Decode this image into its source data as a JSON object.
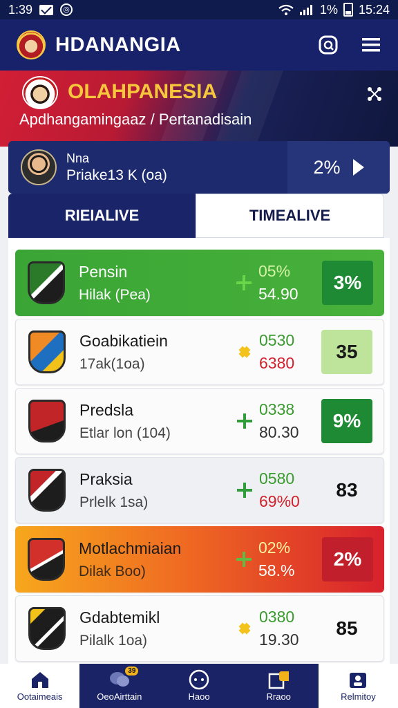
{
  "status_bar": {
    "time": "1:39",
    "battery": "1%",
    "clock": "15:24"
  },
  "app": {
    "title": "HDANANGIA"
  },
  "hero": {
    "brand": "OLAHPANESIA",
    "subtitle": "Apdhangamingaaz / Pertanadisain"
  },
  "profile": {
    "name": "Nna",
    "meta": "Priake13 K (oa)",
    "percent": "2%"
  },
  "tabs": [
    {
      "label": "RIEIALIVE",
      "active": false
    },
    {
      "label": "TIMEALIVE",
      "active": true
    }
  ],
  "rows": [
    {
      "team": "Pensin",
      "detail": "Hilak (Pea)",
      "top": "05%",
      "bottom": "54.90",
      "score": "3%",
      "score_style": "dark",
      "style": "green",
      "trend": "plus",
      "trend_color": "#69d64a",
      "bottom_red": false
    },
    {
      "team": "Goabikatiein",
      "detail": "17ak(1oa)",
      "top": "0530",
      "bottom": "6380",
      "score": "35",
      "score_style": "light",
      "style": "plain",
      "trend": "star",
      "trend_color": "#f3c21b",
      "bottom_red": true
    },
    {
      "team": "Predsla",
      "detail": "Etlar lon (104)",
      "top": "0338",
      "bottom": "80.30",
      "score": "9%",
      "score_style": "dark",
      "style": "plain",
      "trend": "plus",
      "trend_color": "#2f9e3a",
      "bottom_red": false
    },
    {
      "team": "Praksia",
      "detail": "Prlelk 1sa)",
      "top": "0580",
      "bottom": "69%0",
      "score": "83",
      "score_style": "none",
      "style": "plain alt",
      "trend": "plus",
      "trend_color": "#2f9e3a",
      "bottom_red": true
    },
    {
      "team": "Motlachmiaian",
      "detail": "Dilak Boo)",
      "top": "02%",
      "bottom": "58.%",
      "score": "2%",
      "score_style": "red",
      "style": "orange",
      "trend": "plus",
      "trend_color": "#63b944",
      "bottom_red": false
    },
    {
      "team": "Gdabtemikl",
      "detail": "Pilalk 1oa)",
      "top": "0380",
      "bottom": "19.30",
      "score": "85",
      "score_style": "none",
      "style": "plain",
      "trend": "star",
      "trend_color": "#f3c21b",
      "bottom_red": false
    }
  ],
  "bottom_nav": [
    {
      "label": "Ootaimeais",
      "icon": "home-icon",
      "active": true
    },
    {
      "label": "OeoAirttain",
      "icon": "chat-icon",
      "active": false,
      "badge": "39"
    },
    {
      "label": "Haoo",
      "icon": "game-icon",
      "active": false
    },
    {
      "label": "Rraoo",
      "icon": "store-icon",
      "active": false
    },
    {
      "label": "Relmitoy",
      "icon": "profile-icon",
      "active": false
    }
  ]
}
